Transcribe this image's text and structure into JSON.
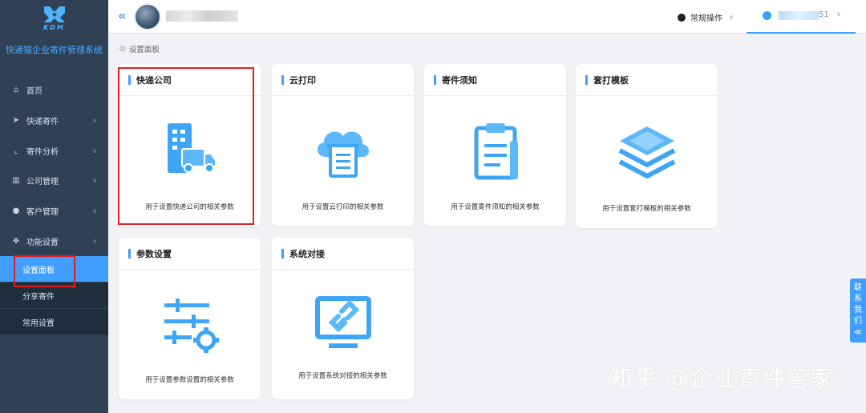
{
  "app": {
    "logo_text": "KDM",
    "brand": "快递猫企业寄件管理系统"
  },
  "sidebar": {
    "items": [
      {
        "label": "首页",
        "icon": "home-icon"
      },
      {
        "label": "快递寄件",
        "icon": "send-icon"
      },
      {
        "label": "寄件分析",
        "icon": "chart-icon"
      },
      {
        "label": "公司管理",
        "icon": "building-icon"
      },
      {
        "label": "客户管理",
        "icon": "user-icon"
      },
      {
        "label": "功能设置",
        "icon": "function-icon"
      }
    ],
    "subitems": [
      {
        "label": "设置面板",
        "active": true
      },
      {
        "label": "分享寄件",
        "active": false
      },
      {
        "label": "常用设置",
        "active": false
      }
    ]
  },
  "topbar": {
    "collapse_icon": "double-chevron-left-icon",
    "ops_label": "常规操作",
    "user_suffix": "51"
  },
  "breadcrumb": {
    "label": "设置面板"
  },
  "cards": [
    {
      "title": "快递公司",
      "desc": "用于设置快递公司的相关参数",
      "icon": "courier-truck-icon"
    },
    {
      "title": "云打印",
      "desc": "用于设置云打印的相关参数",
      "icon": "cloud-print-icon"
    },
    {
      "title": "寄件须知",
      "desc": "用于设置寄件须知的相关参数",
      "icon": "clipboard-icon"
    },
    {
      "title": "套打模板",
      "desc": "用于设置套打模板的相关参数",
      "icon": "layers-icon"
    },
    {
      "title": "参数设置",
      "desc": "用于设置参数设置的相关参数",
      "icon": "sliders-gear-icon"
    },
    {
      "title": "系统对接",
      "desc": "用于设置系统对接的相关参数",
      "icon": "monitor-link-icon"
    }
  ],
  "contact": {
    "chars": [
      "联",
      "系",
      "我",
      "们",
      "≪"
    ]
  },
  "watermark": "知乎 @企业寄件管家",
  "colors": {
    "accent": "#409eff",
    "sidebar": "#304156",
    "highlight": "#e02020"
  }
}
